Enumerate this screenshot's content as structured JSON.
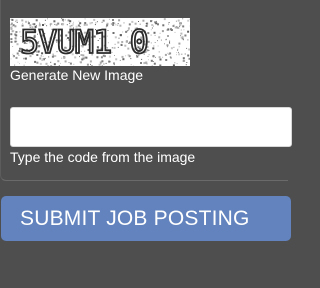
{
  "captcha": {
    "text": "5VUM1 0",
    "refresh_label": "Generate New Image"
  },
  "code_input": {
    "value": "",
    "placeholder": "",
    "hint": "Type the code from the image"
  },
  "submit": {
    "label": "SUBMIT JOB POSTING",
    "color": "#6283bd"
  },
  "colors": {
    "background": "#4e4e4e",
    "text": "#ffffff"
  }
}
